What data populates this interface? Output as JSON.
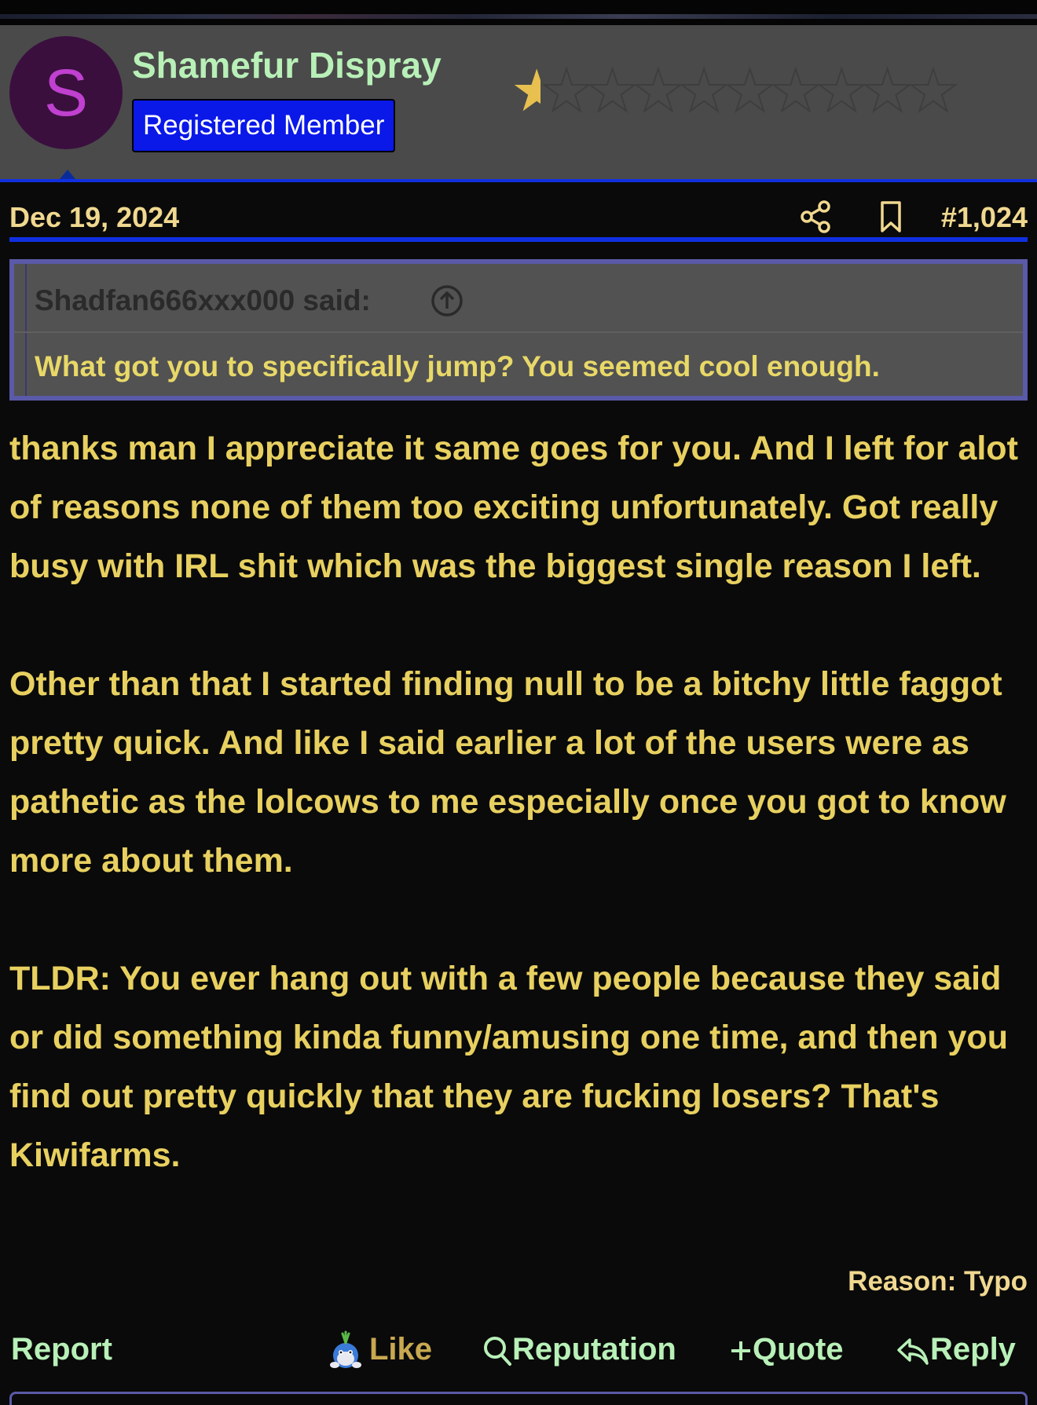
{
  "user": {
    "avatar_letter": "S",
    "name": "Shamefur Dispray",
    "role": "Registered Member",
    "rating": {
      "filled": 0.5,
      "max": 10
    }
  },
  "post": {
    "date": "Dec 19, 2024",
    "number": "#1,024",
    "edit_reason": "Reason: Typo"
  },
  "quote": {
    "author_line": "Shadfan666xxx000 said:",
    "text": "What got you to specifically jump? You seemed cool enough."
  },
  "body": {
    "paragraphs": [
      "thanks man I appreciate it same goes for you. And I left for alot of reasons none of them too exciting unfortunately. Got really busy with IRL shit which was the biggest single reason I left.",
      "Other than that I started finding null to be a bitchy little faggot pretty quick. And like I said earlier a lot of the users were as pathetic as the lolcows to me especially once you got to know more about them.",
      "TLDR: You ever hang out with a few people because they said or did something kinda funny/amusing one time, and then you find out pretty quickly that they are fucking losers? That's Kiwifarms."
    ]
  },
  "actions": {
    "report": "Report",
    "like": "Like",
    "reputation": "Reputation",
    "quote": "Quote",
    "reply": "Reply"
  },
  "icons": {
    "share": "share-icon",
    "bookmark": "bookmark-icon",
    "jump": "arrow-up-circle-icon",
    "search": "search-icon",
    "plus": "plus-icon",
    "reply": "reply-arrow-icon",
    "like": "mascot-icon"
  },
  "colors": {
    "username": "#b8f0b8",
    "badge": "#0a18e8",
    "accent_border": "#1030e0",
    "text": "#e8d060",
    "meta": "#f0d890"
  }
}
